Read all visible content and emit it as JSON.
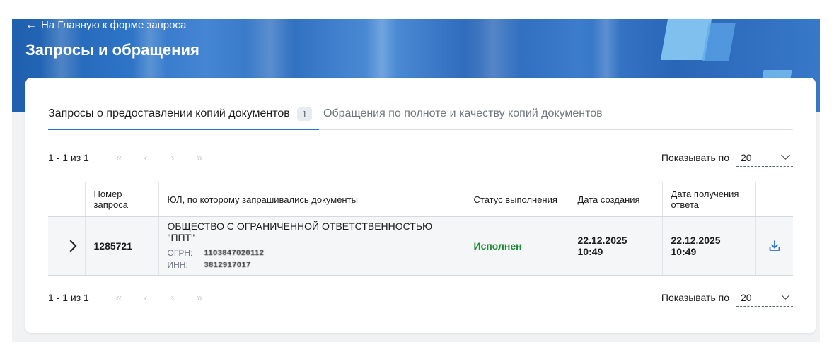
{
  "header": {
    "back_link": "На Главную к форме запроса",
    "title": "Запросы и обращения"
  },
  "tabs": [
    {
      "label": "Запросы о предоставлении копий документов",
      "badge": "1",
      "active": true
    },
    {
      "label": "Обращения по полноте и качеству копий документов",
      "active": false
    }
  ],
  "pager": {
    "count_label": "1 - 1 из 1",
    "first": "«",
    "prev": "‹",
    "next": "›",
    "last": "»",
    "page_size_label": "Показывать по",
    "page_size_value": "20"
  },
  "table": {
    "columns": {
      "number": "Номер запроса",
      "org": "ЮЛ, по которому запрашивались документы",
      "status": "Статус выполнения",
      "created": "Дата создания",
      "answered": "Дата получения ответа"
    },
    "rows": [
      {
        "number": "1285721",
        "org_name": "ОБЩЕСТВО С ОГРАНИЧЕННОЙ ОТВЕТСТВЕННОСТЬЮ \"ППТ\"",
        "ogrn_label": "ОГРН:",
        "ogrn_value": "1103847020112",
        "inn_label": "ИНН:",
        "inn_value": "3812917017",
        "status": "Исполнен",
        "created": "22.12.2025 10:49",
        "answered": "22.12.2025 10:49"
      }
    ]
  },
  "colors": {
    "accent": "#2a6fd6",
    "status_done": "#1e8c34",
    "hero": "#2d6bbe"
  },
  "icons": {
    "back": "arrow-left-icon",
    "expand": "chevron-right-icon",
    "download": "download-icon",
    "dropdown": "chevron-down-icon"
  }
}
